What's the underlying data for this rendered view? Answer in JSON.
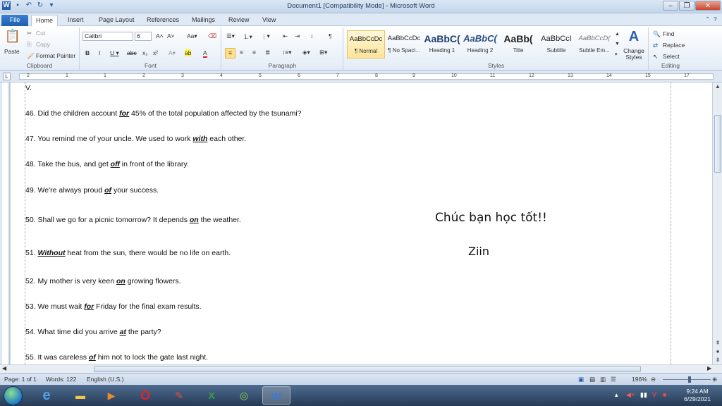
{
  "window": {
    "title": "Document1 [Compatibility Mode] - Microsoft Word"
  },
  "tabs": [
    "File",
    "Home",
    "Insert",
    "Page Layout",
    "References",
    "Mailings",
    "Review",
    "View"
  ],
  "ribbon": {
    "clipboard": {
      "paste": "Paste",
      "cut": "Cut",
      "copy": "Copy",
      "format_painter": "Format Painter",
      "label": "Clipboard"
    },
    "font": {
      "name": "Calibri",
      "size": "6",
      "label": "Font"
    },
    "paragraph": {
      "label": "Paragraph"
    },
    "styles": {
      "label": "Styles",
      "items": [
        {
          "sample": "AaBbCcDc",
          "name": "¶ Normal"
        },
        {
          "sample": "AaBbCcDc",
          "name": "¶ No Spaci..."
        },
        {
          "sample": "AaBbC(",
          "name": "Heading 1"
        },
        {
          "sample": "AaBbC(",
          "name": "Heading 2"
        },
        {
          "sample": "AaBb(",
          "name": "Title"
        },
        {
          "sample": "AaBbCcI",
          "name": "Subtitle"
        },
        {
          "sample": "AaBbCcD(",
          "name": "Subtle Em..."
        }
      ],
      "change_styles": "Change Styles"
    },
    "editing": {
      "find": "Find",
      "replace": "Replace",
      "select": "Select",
      "label": "Editing"
    }
  },
  "ruler_numbers": [
    "1",
    "2",
    "1",
    "2",
    "3",
    "4",
    "5",
    "6",
    "7",
    "8",
    "9",
    "10",
    "11",
    "12",
    "13",
    "14",
    "15",
    "16",
    "17"
  ],
  "document": {
    "top_fragment": "V.",
    "lines": [
      {
        "pre": "46. Did the children account ",
        "key": "for",
        "post": " 45% of the total population affected by the tsunami?"
      },
      {
        "pre": "47. You remind me of your uncle. We used to work ",
        "key": "with",
        "post": " each other."
      },
      {
        "pre": "48. Take the bus, and get ",
        "key": "off",
        "post": " in front of the library."
      },
      {
        "pre": "49. We're always proud ",
        "key": "of",
        "post": " your success."
      },
      {
        "pre": "50. Shall we go for a picnic tomorrow? It depends ",
        "key": "on",
        "post": " the weather."
      },
      {
        "pre": "51. ",
        "key": "Without",
        "post": " heat from the sun, there would be no life on earth."
      },
      {
        "pre": "52. My mother is very keen ",
        "key": "on",
        "post": " growing flowers."
      },
      {
        "pre": "53. We must wait ",
        "key": "for",
        "post": " Friday for the final exam results."
      },
      {
        "pre": "54. What time did you arrive ",
        "key": "at",
        "post": " the party?"
      },
      {
        "pre": "55. It was careless ",
        "key": "of",
        "post": " him not to lock the gate last night."
      }
    ],
    "note_wish": "Chúc bạn học tốt!!",
    "note_author": "Ziin"
  },
  "status": {
    "page": "Page: 1 of 1",
    "words": "Words: 122",
    "language": "English (U.S.)",
    "zoom": "196%"
  },
  "taskbar": {
    "time": "9:24 AM",
    "date": "6/29/2021"
  }
}
